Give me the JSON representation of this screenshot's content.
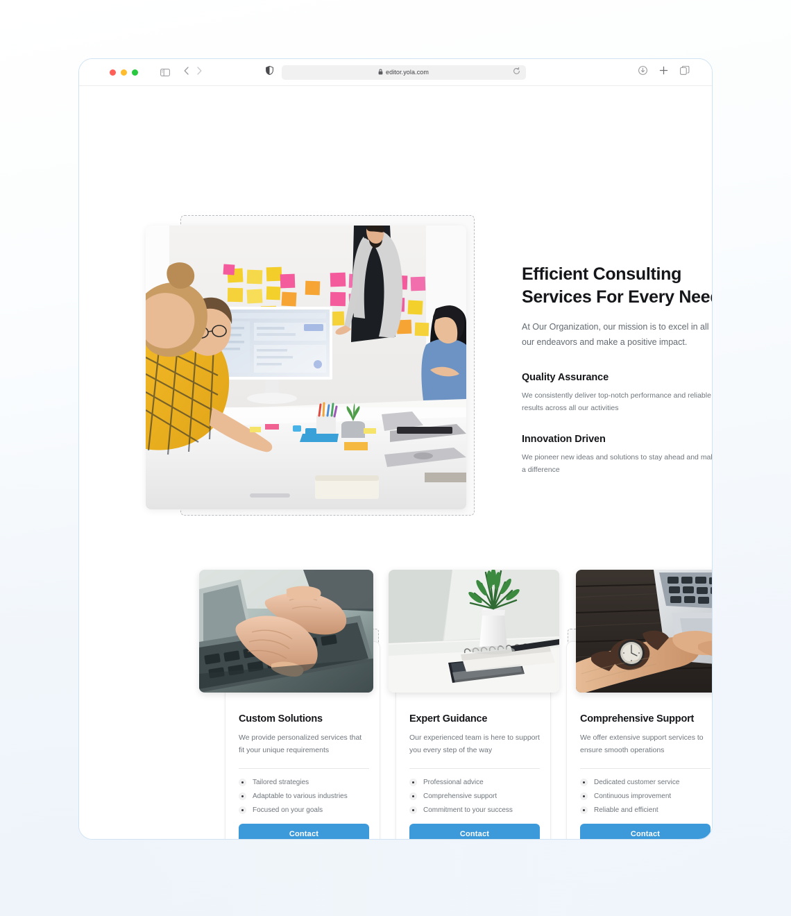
{
  "browser": {
    "url": "editor.yola.com",
    "icons": {
      "sidebar": "sidebar-toggle-icon",
      "back": "back-chevron-icon",
      "forward": "forward-chevron-icon",
      "shield": "privacy-shield-icon",
      "lock": "lock-icon",
      "reload": "reload-icon",
      "download": "download-icon",
      "new_tab": "plus-icon",
      "tab_overview": "tab-overview-icon"
    },
    "traffic_lights": {
      "close": "#ff5f57",
      "minimize": "#febc2e",
      "zoom": "#28c840"
    }
  },
  "hero": {
    "title": "Efficient Consulting Services For Every Need",
    "subtitle": "At Our Organization, our mission is to excel in all our endeavors and make a positive impact.",
    "features": [
      {
        "title": "Quality Assurance",
        "body": "We consistently deliver top-notch performance and reliable results across all our activities"
      },
      {
        "title": "Innovation Driven",
        "body": "We pioneer new ideas and solutions to stay ahead and make a difference"
      }
    ],
    "image_alt": "team-collaboration-sticky-notes-photo"
  },
  "cards": [
    {
      "title": "Custom Solutions",
      "description": "We provide personalized services that fit your unique requirements",
      "bullets": [
        "Tailored strategies",
        "Adaptable to various industries",
        "Focused on your goals"
      ],
      "button": "Contact",
      "image_alt": "hands-typing-on-laptop-photo"
    },
    {
      "title": "Expert Guidance",
      "description": "Our experienced team is here to support you every step of the way",
      "bullets": [
        "Professional advice",
        "Comprehensive support",
        "Commitment to your success"
      ],
      "button": "Contact",
      "image_alt": "desk-plant-notebook-phone-photo"
    },
    {
      "title": "Comprehensive Support",
      "description": "We offer extensive support services to ensure smooth operations",
      "bullets": [
        "Dedicated customer service",
        "Continuous improvement",
        "Reliable and efficient"
      ],
      "button": "Contact",
      "image_alt": "wrist-watch-hand-on-laptop-photo"
    }
  ],
  "colors": {
    "accent": "#3d9ada",
    "heading": "#15161a",
    "body_text": "#6e757c",
    "window_border": "#cfe3f4",
    "dashed_outline": "#b9bcc0",
    "page_background": "#f1f6fb"
  }
}
